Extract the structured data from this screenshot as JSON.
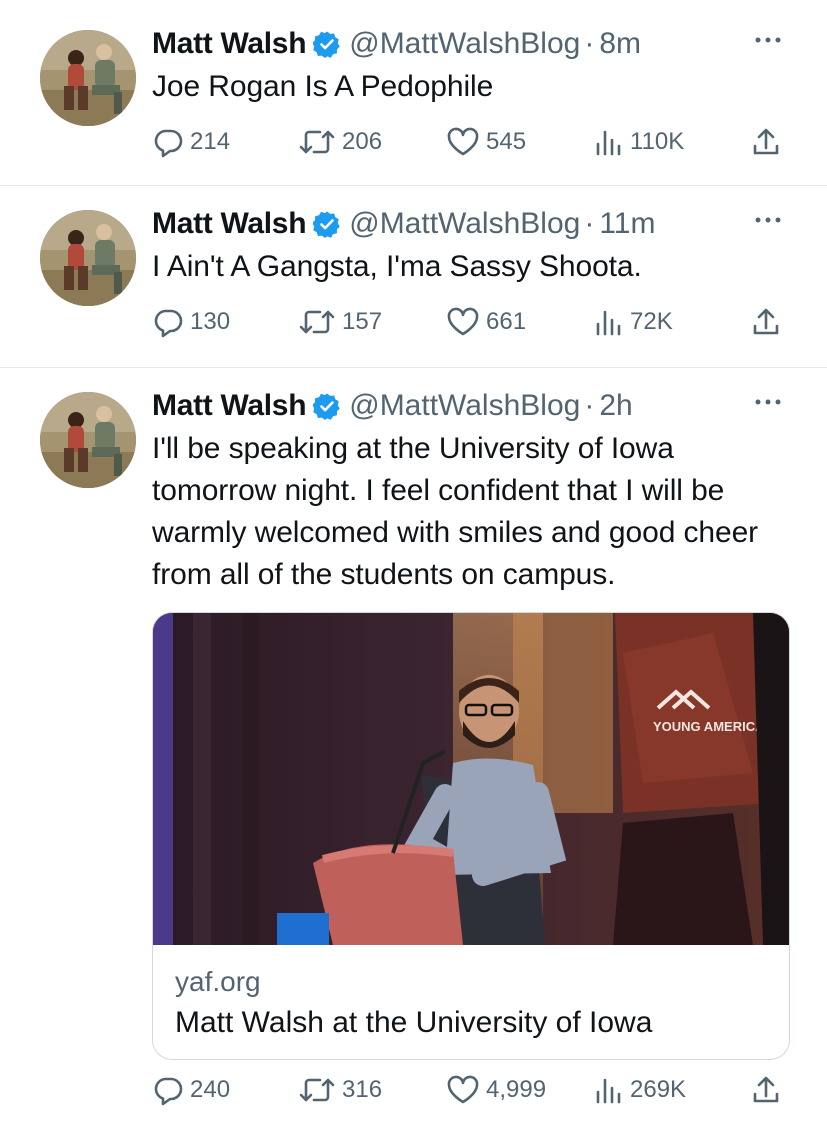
{
  "tweets": [
    {
      "name": "Matt Walsh",
      "handle": "@MattWalshBlog",
      "separator": "·",
      "time": "8m",
      "text": "Joe Rogan Is A Pedophile",
      "replies": "214",
      "retweets": "206",
      "likes": "545",
      "views": "110K"
    },
    {
      "name": "Matt Walsh",
      "handle": "@MattWalshBlog",
      "separator": "·",
      "time": "11m",
      "text": "I Ain't A Gangsta, I'ma Sassy Shoota.",
      "replies": "130",
      "retweets": "157",
      "likes": "661",
      "views": "72K"
    },
    {
      "name": "Matt Walsh",
      "handle": "@MattWalshBlog",
      "separator": "·",
      "time": "2h",
      "text": "I'll be speaking at the University of Iowa tomorrow night. I feel confident that I will be warmly welcomed with smiles and good cheer from all of the students on campus.",
      "card": {
        "domain": "yaf.org",
        "title": "Matt Walsh at the University of Iowa",
        "banner_text": "YOUNG AMERICA'S"
      },
      "replies": "240",
      "retweets": "316",
      "likes": "4,999",
      "views": "269K"
    }
  ],
  "icons": {
    "reply": "reply-icon",
    "retweet": "retweet-icon",
    "like": "heart-icon",
    "views": "views-icon",
    "share": "share-icon",
    "more": "more-icon",
    "verified": "verified-badge-icon"
  },
  "colors": {
    "verified": "#1d9bf0",
    "secondary_text": "#536471",
    "primary_text": "#0f1419"
  }
}
